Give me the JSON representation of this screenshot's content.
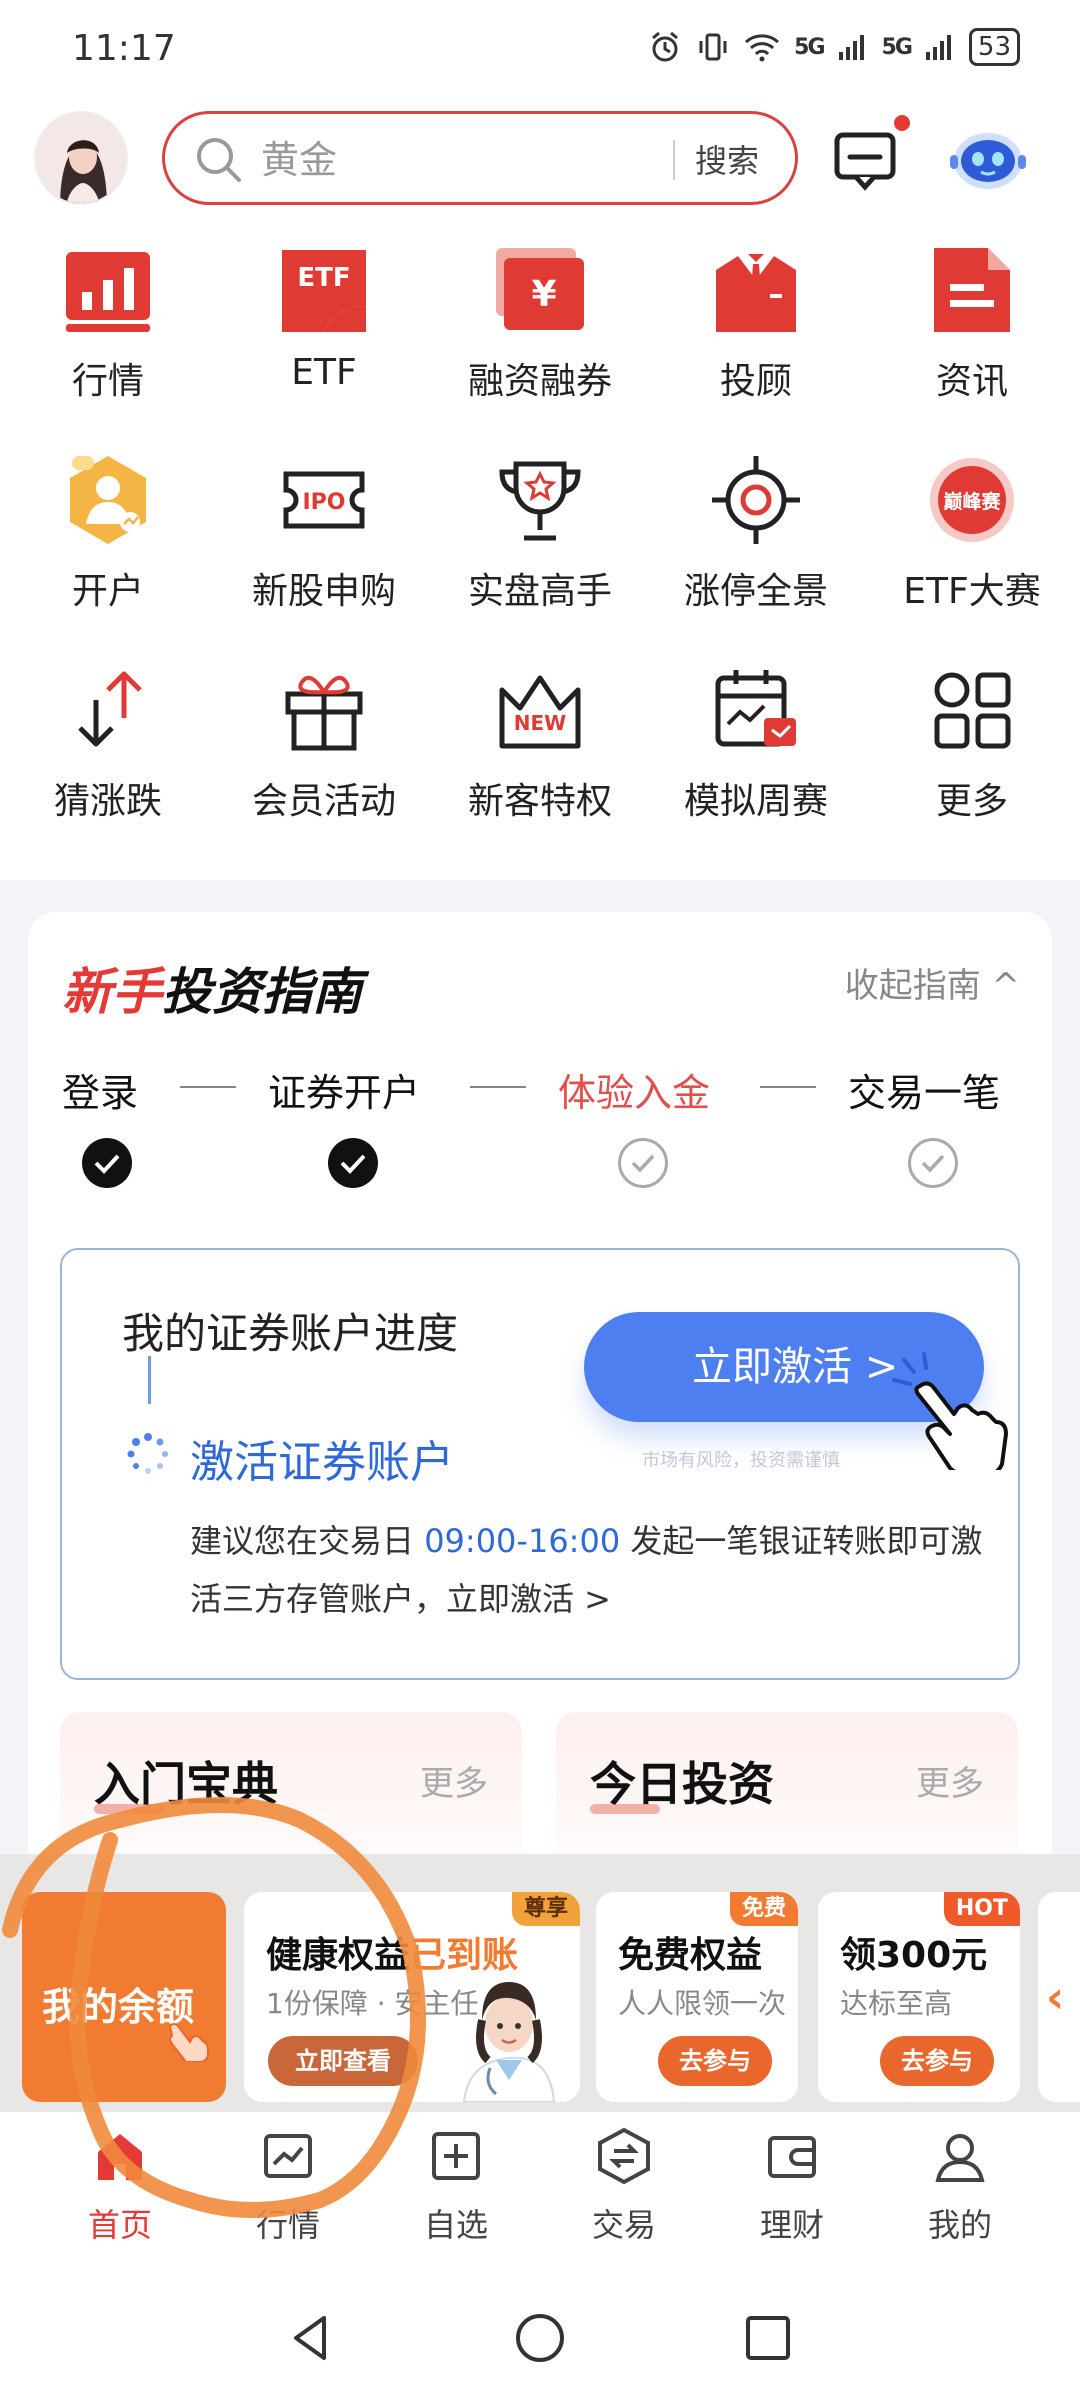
{
  "status_bar": {
    "time": "11:17",
    "network_1": "5G",
    "network_2": "5G",
    "battery": "53"
  },
  "search": {
    "placeholder": "黄金",
    "button": "搜索"
  },
  "grid": {
    "items": [
      {
        "label": "行情",
        "icon": "chart-bars-icon"
      },
      {
        "label": "ETF",
        "icon": "etf-icon"
      },
      {
        "label": "融资融券",
        "icon": "yen-card-icon"
      },
      {
        "label": "投顾",
        "icon": "advisor-suit-icon"
      },
      {
        "label": "资讯",
        "icon": "document-icon"
      },
      {
        "label": "开户",
        "icon": "account-open-icon"
      },
      {
        "label": "新股申购",
        "icon": "ipo-ticket-icon"
      },
      {
        "label": "实盘高手",
        "icon": "trophy-icon"
      },
      {
        "label": "涨停全景",
        "icon": "target-icon"
      },
      {
        "label": "ETF大赛",
        "icon": "peak-contest-icon",
        "badge": "巅峰赛"
      },
      {
        "label": "猜涨跌",
        "icon": "up-down-arrows-icon"
      },
      {
        "label": "会员活动",
        "icon": "gift-icon"
      },
      {
        "label": "新客特权",
        "icon": "crown-new-icon",
        "badge": "NEW"
      },
      {
        "label": "模拟周赛",
        "icon": "calendar-chart-icon"
      },
      {
        "label": "更多",
        "icon": "grid-more-icon"
      }
    ],
    "ipo_text": "IPO",
    "yen": "¥"
  },
  "guide": {
    "title_red": "新手",
    "title_black": "投资指南",
    "collapse": "收起指南 ^",
    "steps": [
      {
        "label": "登录",
        "status": "done"
      },
      {
        "label": "证券开户",
        "status": "done"
      },
      {
        "label": "体验入金",
        "status": "active"
      },
      {
        "label": "交易一笔",
        "status": "pending"
      }
    ],
    "progress": {
      "title": "我的证券账户进度",
      "button": "立即激活 >",
      "risk": "市场有风险，投资需谨慎",
      "activate_title": "激活证券账户",
      "desc_prefix": "建议您在交易日",
      "desc_time": "09:00-16:00",
      "desc_suffix": "发起一笔银证转账即可激活三方存管账户，立即激活 >"
    },
    "cards": [
      {
        "title": "入门宝典",
        "more": "更多"
      },
      {
        "title": "今日投资",
        "more": "更多"
      }
    ]
  },
  "promo": {
    "main": "我的余额",
    "cards": [
      {
        "badge": "尊享",
        "title_a": "健康权益",
        "title_b": "已到账",
        "sub": "1份保障 · 安主任",
        "button": "立即查看"
      },
      {
        "badge": "免费",
        "title": "免费权益",
        "sub": "人人限领一次",
        "button": "去参与"
      },
      {
        "badge": "HOT",
        "title": "领300元",
        "sub": "达标至高",
        "button": "去参与"
      }
    ],
    "arrow": "‹"
  },
  "nav": {
    "items": [
      {
        "label": "首页",
        "active": true
      },
      {
        "label": "行情"
      },
      {
        "label": "自选"
      },
      {
        "label": "交易"
      },
      {
        "label": "理财"
      },
      {
        "label": "我的"
      }
    ]
  },
  "colors": {
    "brand_red": "#e53935",
    "accent_blue": "#4e7ff0",
    "promo_orange": "#f07b31"
  }
}
